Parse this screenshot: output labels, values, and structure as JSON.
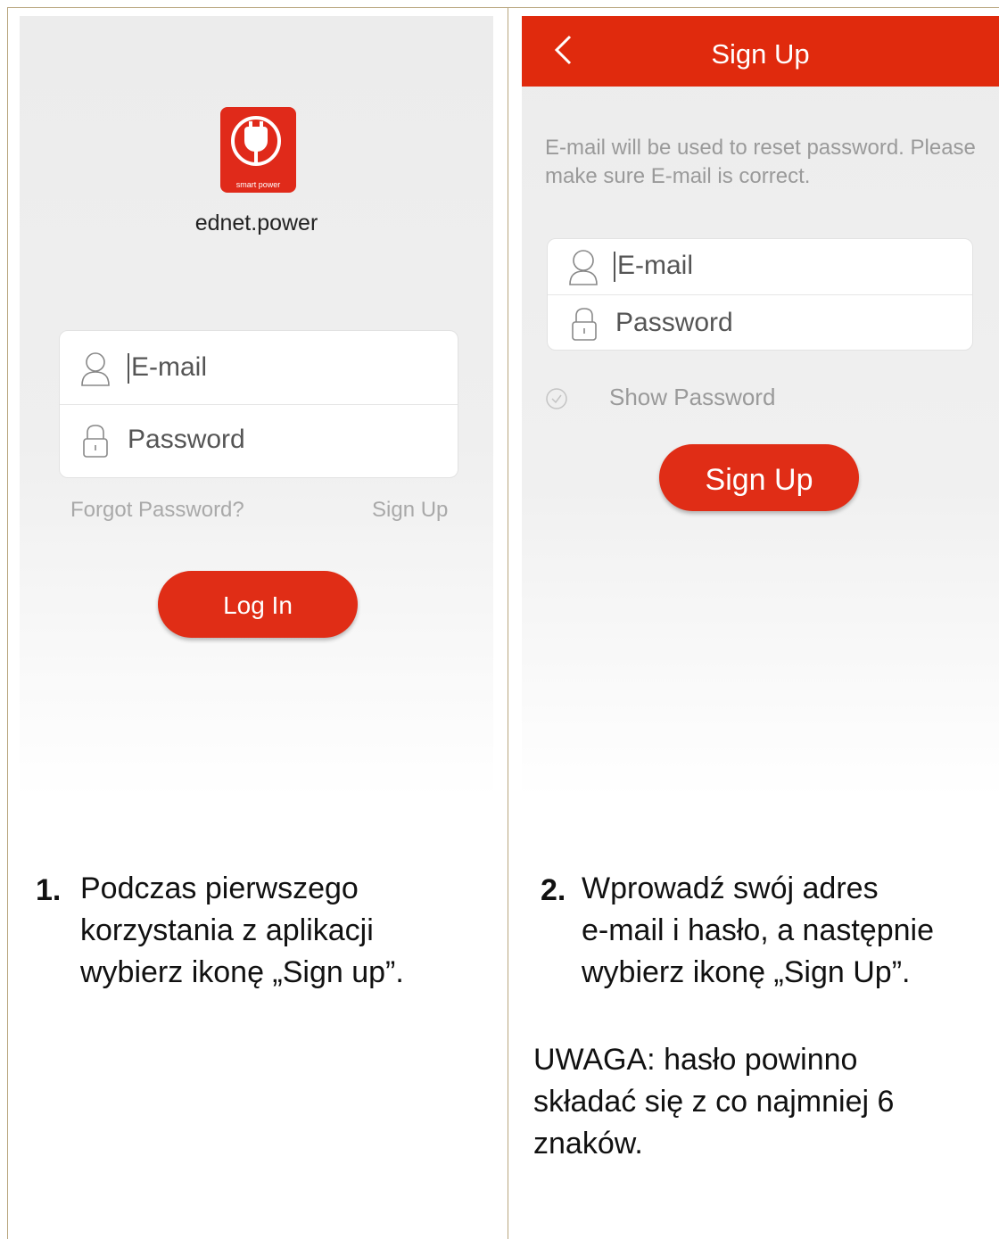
{
  "left_screen": {
    "app_icon_caption": "smart power",
    "app_name": "ednet.power",
    "email_placeholder": "E-mail",
    "password_placeholder": "Password",
    "forgot_password": "Forgot Password?",
    "sign_up_link": "Sign Up",
    "login_button": "Log In"
  },
  "right_screen": {
    "header_title": "Sign Up",
    "notice": "E-mail will be used to reset password. Please make sure E-mail is correct.",
    "email_placeholder": "E-mail",
    "password_placeholder": "Password",
    "show_password": "Show Password",
    "signup_button": "Sign Up"
  },
  "steps": [
    {
      "number": "1.",
      "text": "Podczas pierwszego korzystania z aplikacji wybierz ikonę „Sign up”.",
      "lines": [
        "Podczas pierwszego",
        "korzystania z aplikacji",
        "wybierz ikonę „Sign up”."
      ]
    },
    {
      "number": "2.",
      "text": "Wprowadź swój adres e-mail i hasło, a następnie wybierz ikonę „Sign Up”.",
      "lines": [
        "Wprowadź swój adres",
        "e-mail i hasło, a następnie",
        "wybierz ikonę „Sign Up”."
      ]
    }
  ],
  "note": {
    "lines": [
      "UWAGA: hasło powinno",
      "składać się z co najmniej 6",
      "znaków."
    ]
  },
  "colors": {
    "accent": "#e02a0d",
    "border": "#b9a67e"
  }
}
